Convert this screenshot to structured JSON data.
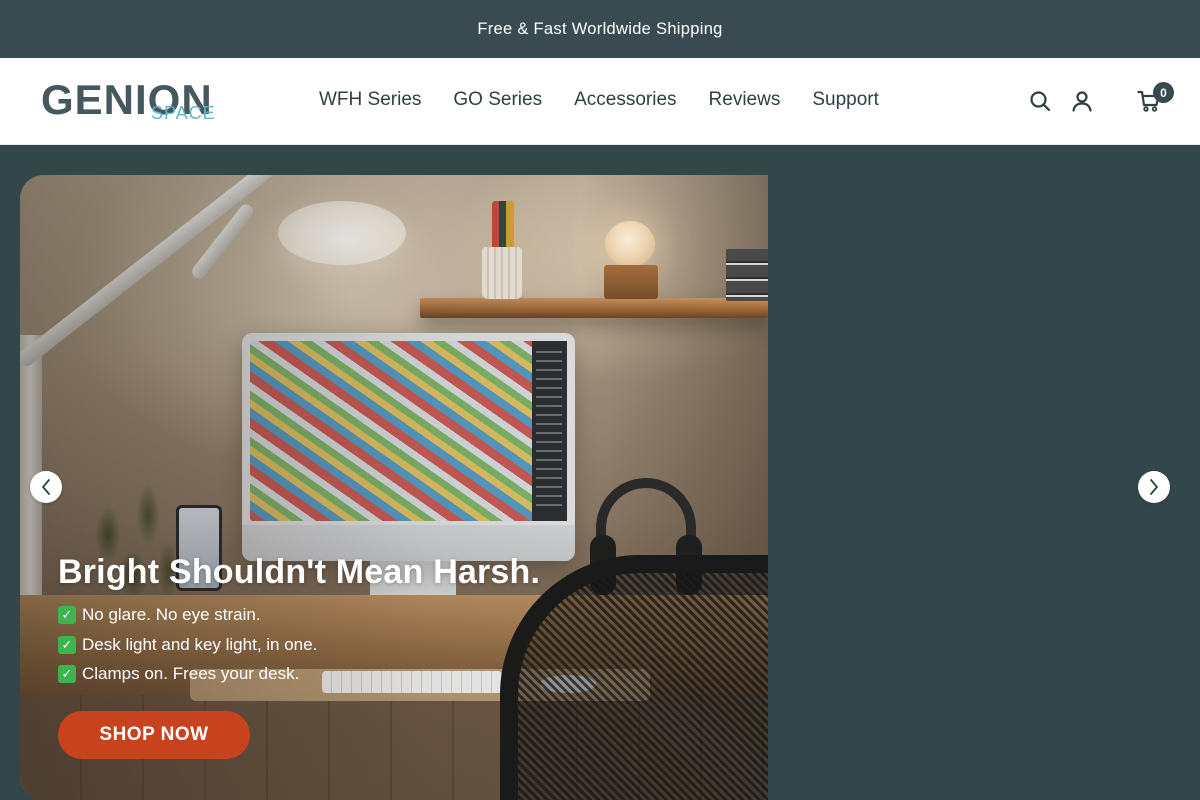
{
  "announcement": {
    "text": "Free & Fast Worldwide Shipping"
  },
  "header": {
    "logo": {
      "main": "GENION",
      "sub": "SPACE"
    },
    "nav": [
      {
        "label": "WFH Series"
      },
      {
        "label": "GO Series"
      },
      {
        "label": "Accessories"
      },
      {
        "label": "Reviews"
      },
      {
        "label": "Support"
      }
    ],
    "icons": {
      "search": "search-icon",
      "account": "user-icon",
      "cart": "cart-icon"
    },
    "cart_count": "0"
  },
  "hero": {
    "title": "Bright Shouldn't Mean Harsh.",
    "bullets": [
      {
        "check": "✓",
        "text": "No glare. No eye strain."
      },
      {
        "check": "✓",
        "text": "Desk light and key light, in one."
      },
      {
        "check": "✓",
        "text": "Clamps on. Frees your desk."
      }
    ],
    "cta_label": "SHOP NOW",
    "prev_icon": "chevron-left-icon",
    "next_icon": "chevron-right-icon"
  },
  "colors": {
    "announcement_bg": "#394b50",
    "page_bg": "#33474a",
    "brand_dark": "#45585d",
    "brand_accent": "#5fb6c7",
    "cta": "#c8431d",
    "check": "#3fb34f"
  }
}
